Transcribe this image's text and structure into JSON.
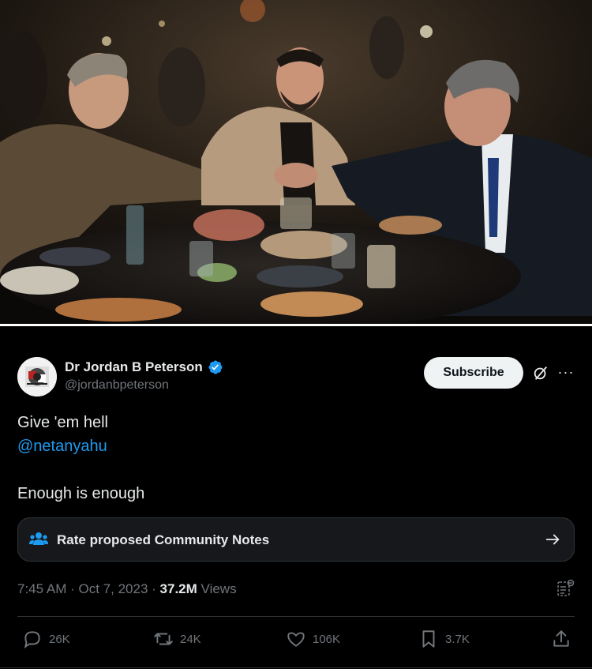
{
  "post": {
    "author_name": "Dr Jordan B Peterson",
    "author_handle": "@jordanbpeterson",
    "subscribe_label": "Subscribe",
    "text_line1": "Give 'em hell",
    "mention": "@netanyahu",
    "text_line3": "Enough is enough",
    "community_notes_label": "Rate proposed Community Notes",
    "time": "7:45 AM",
    "date": "Oct 7, 2023",
    "views_count": "37.2M",
    "views_label": "Views",
    "separator": "·"
  },
  "actions": {
    "replies": "26K",
    "reposts": "24K",
    "likes": "106K",
    "bookmarks": "3.7K"
  },
  "icons": [
    "verified-badge-icon",
    "grok-icon",
    "more-icon",
    "people-icon",
    "arrow-right-icon",
    "analytics-icon",
    "reply-icon",
    "repost-icon",
    "like-icon",
    "bookmark-icon",
    "share-icon"
  ],
  "colors": {
    "accent": "#1d9bf0",
    "text_primary": "#e7e9ea",
    "text_secondary": "#71767b",
    "background": "#000000"
  }
}
